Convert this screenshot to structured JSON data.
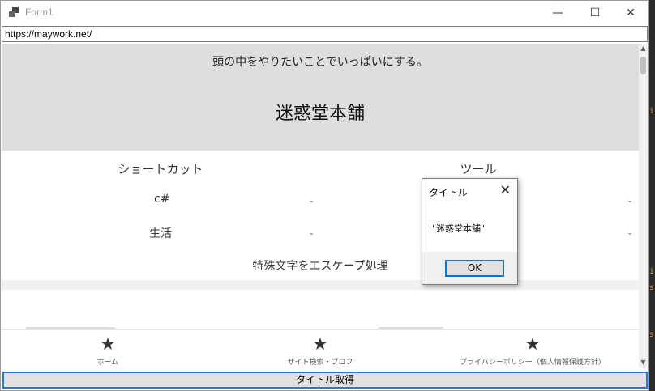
{
  "window": {
    "title": "Form1",
    "minimize_glyph": "—",
    "maximize_glyph": "☐",
    "close_glyph": "✕"
  },
  "address": {
    "value": "https://maywork.net/"
  },
  "page": {
    "tagline": "頭の中をやりたいことでいっぱいにする。",
    "site_title": "迷惑堂本舗",
    "columns": [
      {
        "heading": "ショートカット",
        "items": [
          "c#",
          "生活"
        ]
      },
      {
        "heading": "ツール",
        "items": [
          "",
          ""
        ]
      }
    ],
    "escape_link": "特殊文字をエスケープ処理"
  },
  "bottom_nav": [
    {
      "label": "ホーム",
      "icon": "star-icon"
    },
    {
      "label": "サイト検索・プロフ",
      "icon": "star-icon"
    },
    {
      "label": "プライバシーポリシー（個人情報保護方針）",
      "icon": "star-icon"
    }
  ],
  "action_button": {
    "label": "タイトル取得"
  },
  "dialog": {
    "title": "タイトル",
    "message": "\"迷惑堂本舗\"",
    "ok_label": "OK"
  },
  "colors": {
    "header_bg": "#dedede",
    "focus_border": "#0078d7",
    "background_accent": "#d9a03a"
  }
}
